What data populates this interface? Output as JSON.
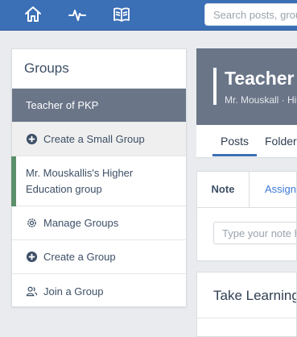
{
  "topbar": {
    "nav_icons": [
      "home-icon",
      "activity-icon",
      "library-icon"
    ],
    "search_placeholder": "Search posts, groups",
    "color": "#3b6fb6"
  },
  "groups": {
    "title": "Groups",
    "active_item": "Teacher of PKP",
    "items": [
      {
        "label": "Create a Small Group",
        "icon": "plus-circle-icon"
      },
      {
        "label_line1": "Mr. Mouskallis's Higher",
        "label_line2": "Education group",
        "accent": "#5c8f6b"
      },
      {
        "label": "Manage Groups",
        "icon": "gear-icon"
      },
      {
        "label": "Create a Group",
        "icon": "plus-circle-icon"
      },
      {
        "label": "Join a Group",
        "icon": "users-icon"
      }
    ]
  },
  "main": {
    "header_title": "Teacher of PKP",
    "header_sub": "Mr. Mouskall · Higher Education",
    "tabs": [
      "Posts",
      "Folders"
    ],
    "composer": {
      "tabs": [
        "Note",
        "Assignment"
      ],
      "input_placeholder": "Type your note here..."
    },
    "learn_title": "Take Learning"
  }
}
